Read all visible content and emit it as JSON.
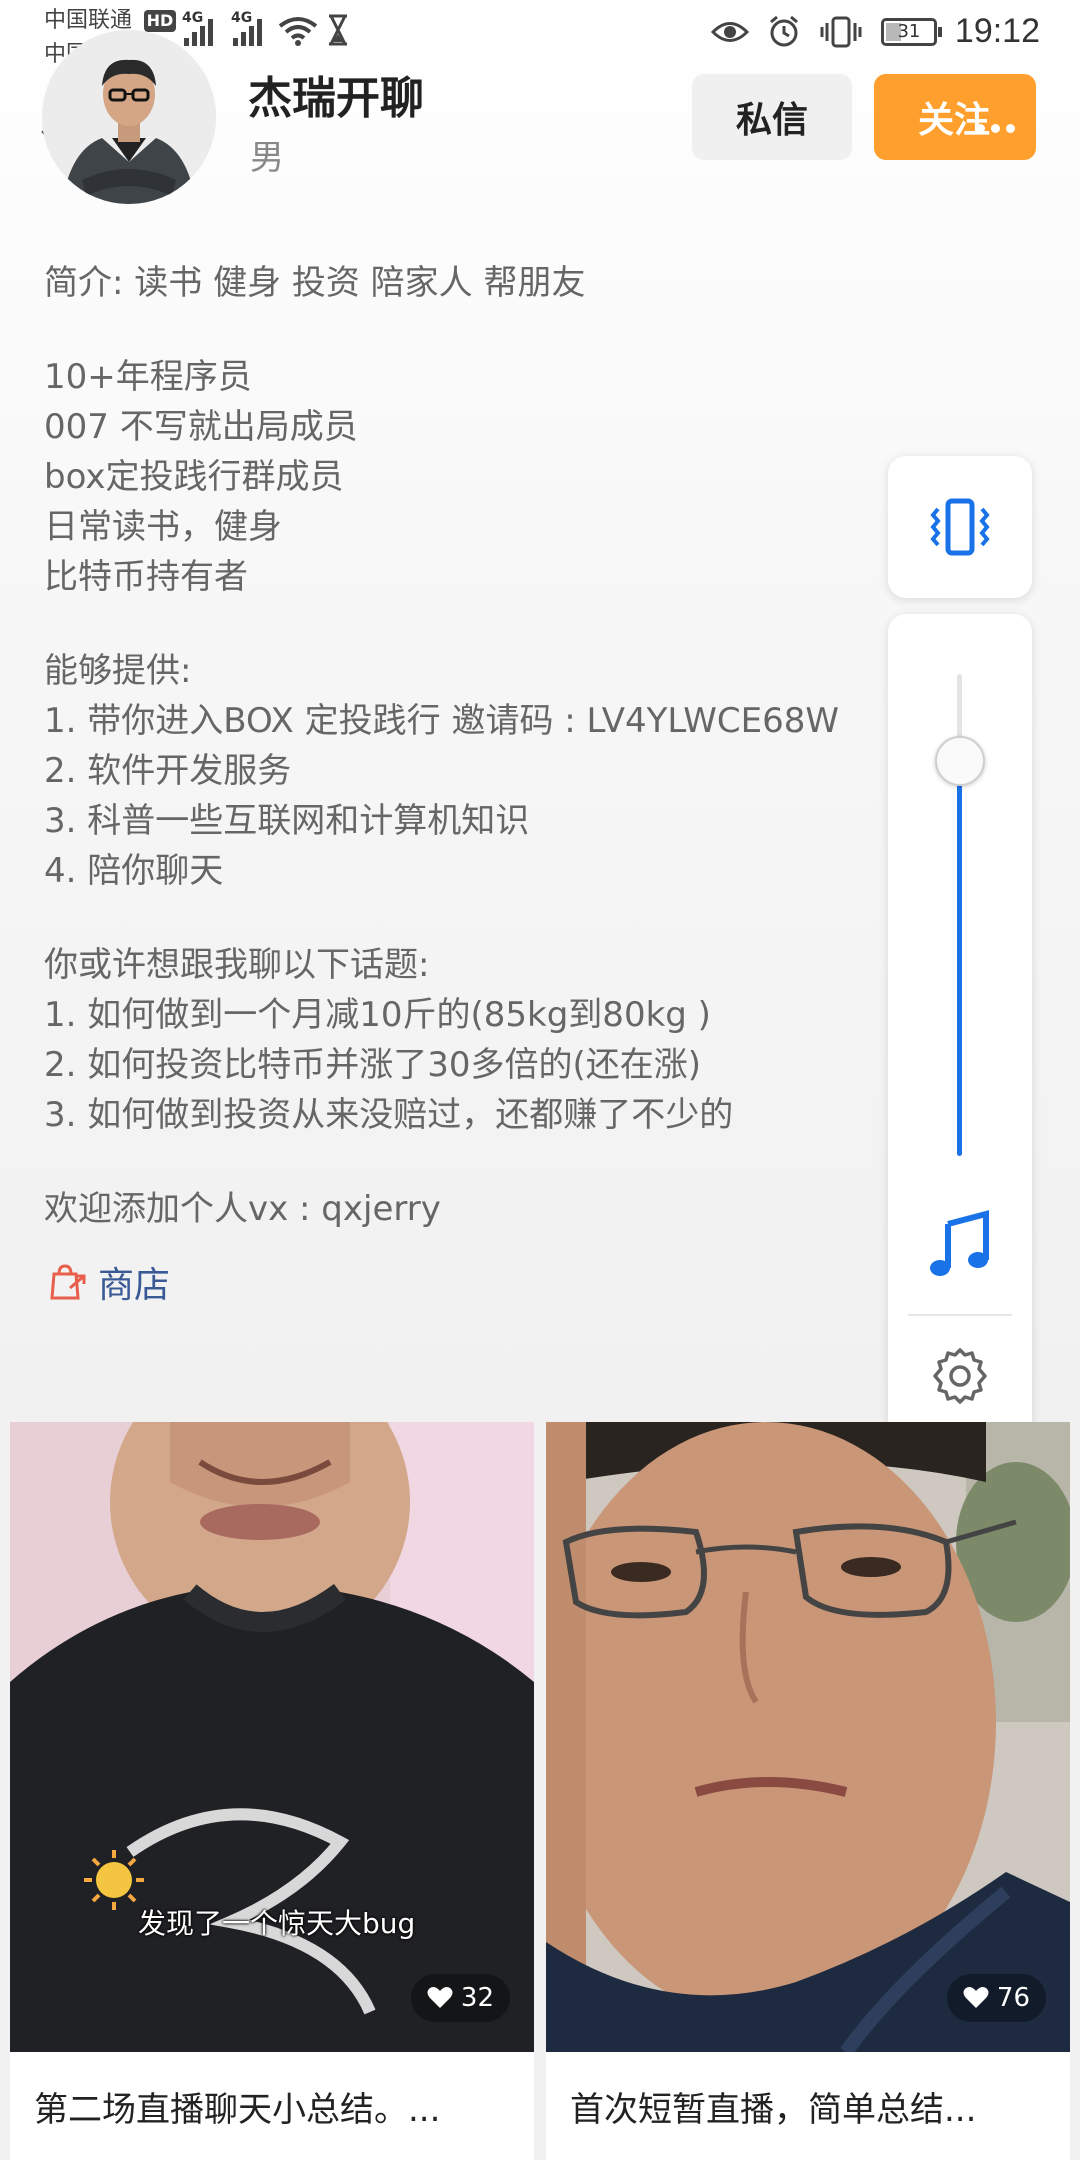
{
  "status_bar": {
    "carrier_1": "中国联通",
    "carrier_2": "中国联",
    "hd": "HD",
    "network_1": "4G",
    "network_2": "4G",
    "battery": "31",
    "battery_level": 0.31,
    "time": "19:12"
  },
  "profile": {
    "name": "杰瑞开聊",
    "gender": "男",
    "message_button": "私信",
    "follow_button": "关注"
  },
  "bio": {
    "lines": [
      "简介: 读书 健身 投资 陪家人 帮朋友",
      "",
      "10+年程序员",
      "007 不写就出局成员",
      "box定投践行群成员",
      "日常读书，健身",
      "比特币持有者",
      "",
      "能够提供:",
      "1. 带你进入BOX 定投践行 邀请码 : LV4YLWCE68W",
      "2. 软件开发服务",
      "3. 科普一些互联网和计算机知识",
      "4. 陪你聊天",
      "",
      "你或许想跟我聊以下话题:",
      "1. 如何做到一个月减10斤的(85kg到80kg )",
      "2. 如何投资比特币并涨了30多倍的(还在涨)",
      "3. 如何做到投资从来没赔过，还都赚了不少的",
      "",
      "欢迎添加个人vx : qxjerry"
    ],
    "shop_label": "商店"
  },
  "volume_panel": {
    "level": 0.82,
    "accent": "#1a72e8"
  },
  "videos": [
    {
      "title": "第二场直播聊天小总结。...",
      "likes": "32",
      "caption": "发现了一个惊天大bug"
    },
    {
      "title": "首次短暂直播，简单总结...",
      "likes": "76",
      "caption": ""
    }
  ],
  "colors": {
    "follow": "#ff9f2e",
    "link": "#3a5a96",
    "shop_icon": "#e8604c"
  }
}
